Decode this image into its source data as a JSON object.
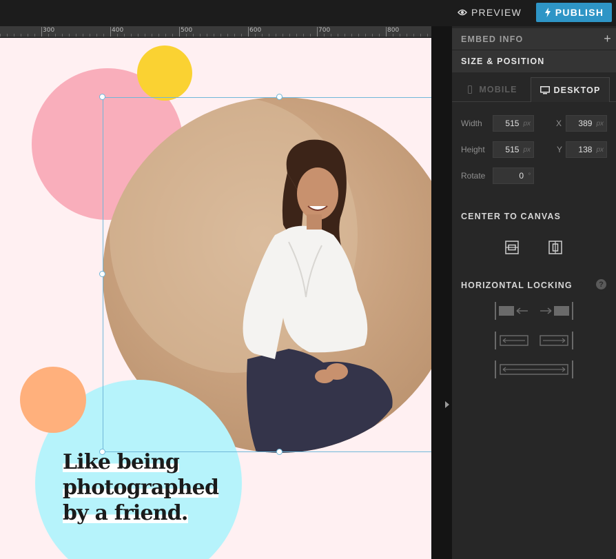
{
  "topbar": {
    "preview_label": "PREVIEW",
    "publish_label": "PUBLISH",
    "publish_color": "#2e95c6"
  },
  "ruler": {
    "labels": [
      "300",
      "400",
      "500",
      "600",
      "700",
      "800"
    ]
  },
  "canvas": {
    "headline": [
      "Like being",
      "photographed",
      "by a friend."
    ],
    "colors": {
      "background": "#fff0f2",
      "pink": "#f9aebb",
      "yellow": "#fad232",
      "blue": "#b6f3fb",
      "orange": "#ffb07c",
      "selection": "#6fb7d9"
    }
  },
  "panel": {
    "embed_info": "EMBED INFO",
    "size_position": "SIZE & POSITION",
    "tabs": {
      "mobile": "MOBILE",
      "desktop": "DESKTOP",
      "active": "DESKTOP"
    },
    "fields": {
      "width": {
        "label": "Width",
        "value": "515",
        "unit": "px"
      },
      "height": {
        "label": "Height",
        "value": "515",
        "unit": "px"
      },
      "x": {
        "label": "X",
        "value": "389",
        "unit": "px"
      },
      "y": {
        "label": "Y",
        "value": "138",
        "unit": "px"
      },
      "rotate": {
        "label": "Rotate",
        "value": "0",
        "unit": "°"
      }
    },
    "center_to_canvas": "CENTER TO CANVAS",
    "horizontal_locking": "HORIZONTAL LOCKING",
    "help_glyph": "?"
  }
}
